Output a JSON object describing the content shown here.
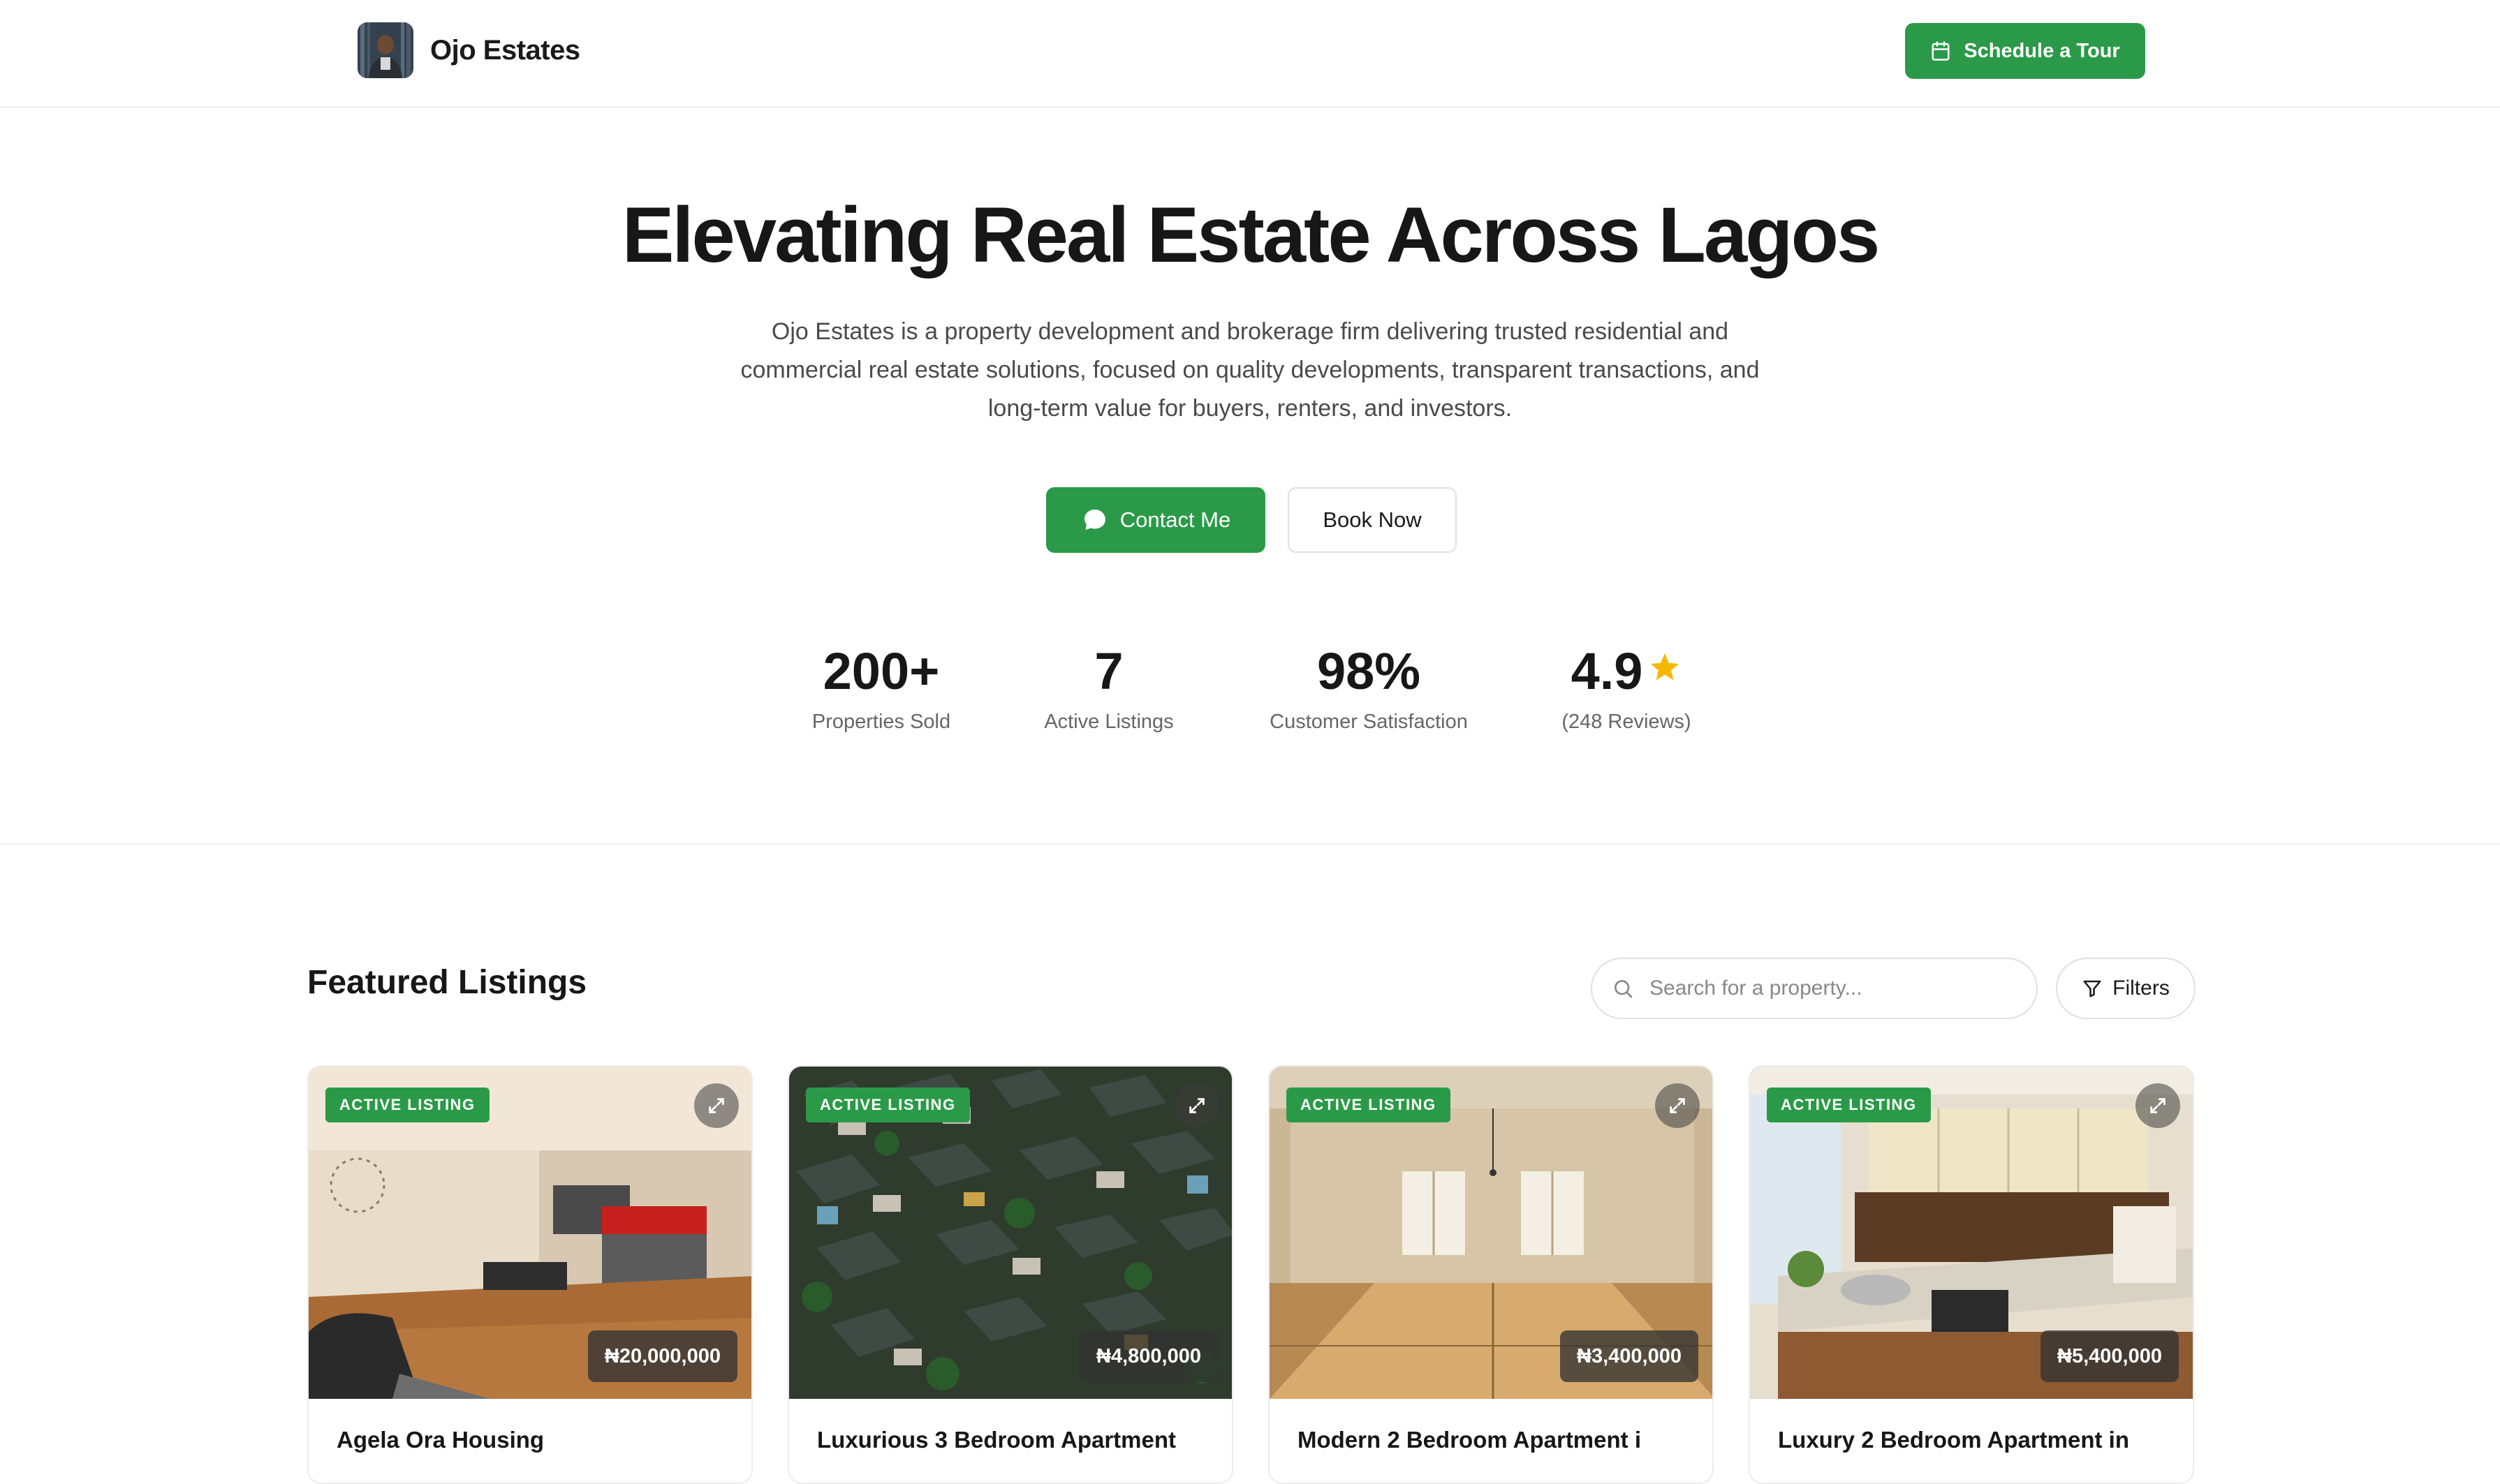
{
  "header": {
    "brand_name": "Ojo Estates",
    "cta_label": "Schedule a Tour",
    "accent_color": "#2b9a48"
  },
  "hero": {
    "title": "Elevating Real Estate Across Lagos",
    "subtitle": "Ojo Estates is a property development and brokerage firm delivering trusted residential and commercial real estate solutions, focused on quality developments, transparent transactions, and long-term value for buyers, renters, and investors.",
    "contact_label": "Contact Me",
    "book_label": "Book Now"
  },
  "stats": [
    {
      "value": "200+",
      "label": "Properties Sold"
    },
    {
      "value": "7",
      "label": "Active Listings"
    },
    {
      "value": "98%",
      "label": "Customer Satisfaction"
    },
    {
      "value": "4.9",
      "label": "(248 Reviews)",
      "icon": "star-icon",
      "icon_color": "#f5b800"
    }
  ],
  "featured": {
    "title": "Featured Listings",
    "search_placeholder": "Search for a property...",
    "filters_label": "Filters",
    "listings": [
      {
        "badge": "ACTIVE LISTING",
        "price": "₦20,000,000",
        "title": "Agela Ora Housing"
      },
      {
        "badge": "ACTIVE LISTING",
        "price": "₦4,800,000",
        "title": "Luxurious 3 Bedroom Apartment"
      },
      {
        "badge": "ACTIVE LISTING",
        "price": "₦3,400,000",
        "title": "Modern 2 Bedroom Apartment i"
      },
      {
        "badge": "ACTIVE LISTING",
        "price": "₦5,400,000",
        "title": "Luxury 2 Bedroom Apartment in"
      }
    ]
  }
}
